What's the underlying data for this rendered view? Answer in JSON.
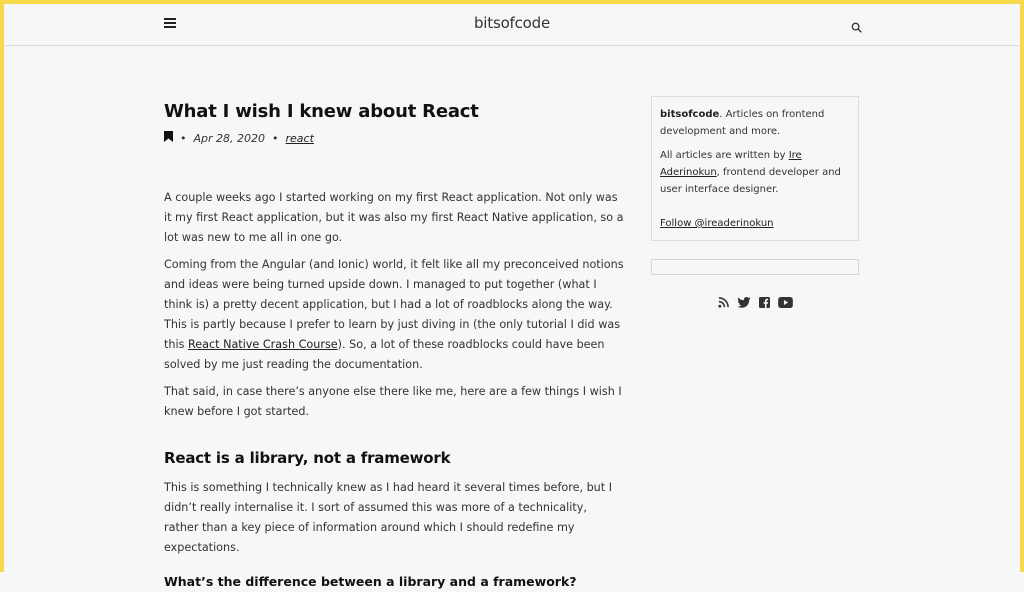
{
  "header": {
    "logo": "bitsofcode",
    "menu_icon": "hamburger-icon",
    "search_icon": "search-icon"
  },
  "post": {
    "title": "What I wish I knew about React",
    "bookmark_icon": "bookmark-icon",
    "date": "Apr 28, 2020",
    "tag": "react",
    "paragraphs": {
      "p1": "A couple weeks ago I started working on my first React application. Not only was it my first React application, but it was also my first React Native application, so a lot was new to me all in one go.",
      "p2_before": "Coming from the Angular (and Ionic) world, it felt like all my preconceived notions and ideas were being turned upside down. I managed to put together (what I think is) a pretty decent application, but I had a lot of roadblocks along the way. This is partly because I prefer to learn by just diving in (the only tutorial I did was this ",
      "p2_link": "React Native Crash Course",
      "p2_after": "). So, a lot of these roadblocks could have been solved by me just reading the documentation.",
      "p3": "That said, in case there’s anyone else there like me, here are a few things I wish I knew before I got started.",
      "h2": "React is a library, not a framework",
      "p4": "This is something I technically knew as I had heard it several times before, but I didn’t really internalise it. I sort of assumed this was more of a technicality, rather than a key piece of information around which I should redefine my expectations.",
      "h3": "What’s the difference between a library and a framework?"
    }
  },
  "sidebar": {
    "brand": "bitsofcode",
    "tagline": ". Articles on frontend development and more.",
    "author_before": "All articles are written by ",
    "author_link": "Ire Aderinokun",
    "author_after": ", frontend developer and user interface designer.",
    "follow": "Follow @ireaderinokun",
    "social_icons": [
      "rss-icon",
      "twitter-icon",
      "facebook-icon",
      "youtube-icon"
    ]
  }
}
